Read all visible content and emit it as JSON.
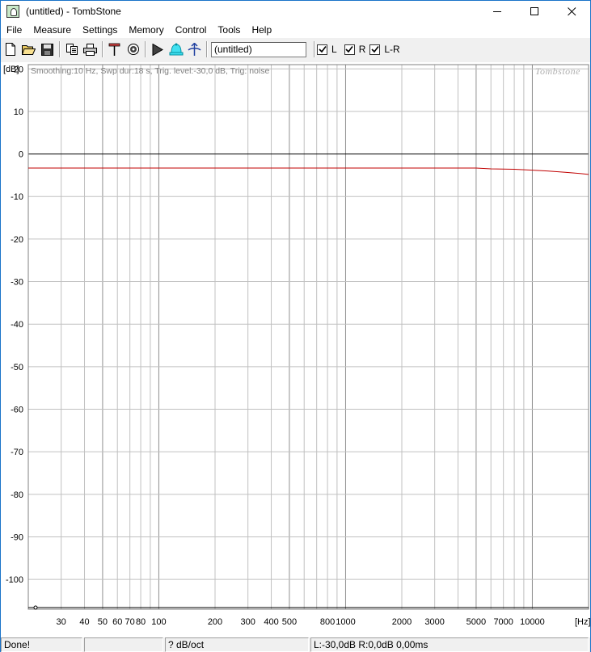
{
  "window": {
    "title": "(untitled) - TombStone"
  },
  "menu": [
    "File",
    "Measure",
    "Settings",
    "Memory",
    "Control",
    "Tools",
    "Help"
  ],
  "toolbar": {
    "name_value": "(untitled)",
    "checkboxes": [
      {
        "label": "L",
        "checked": true
      },
      {
        "label": "R",
        "checked": true
      },
      {
        "label": "L-R",
        "checked": true
      }
    ]
  },
  "graph": {
    "info_text": "Smoothing:10 Hz, Swp dur:18 s, Trig. level:-30,0 dB, Trig: noise",
    "watermark": "Tombstone",
    "y_unit": "[dB]",
    "x_unit": "[Hz]",
    "trace_color": "#c00000"
  },
  "chart_data": {
    "type": "line",
    "xscale": "log",
    "xlim": [
      20,
      20000
    ],
    "ylim": [
      -107,
      21
    ],
    "yticks": [
      20,
      10,
      0,
      -10,
      -20,
      -30,
      -40,
      -50,
      -60,
      -70,
      -80,
      -90,
      -100
    ],
    "xtick_labels": [
      {
        "v": 30,
        "t": "30"
      },
      {
        "v": 40,
        "t": "40"
      },
      {
        "v": 50,
        "t": "50"
      },
      {
        "v": 60,
        "t": "60"
      },
      {
        "v": 70,
        "t": "70"
      },
      {
        "v": 80,
        "t": "80"
      },
      {
        "v": 100,
        "t": "100"
      },
      {
        "v": 200,
        "t": "200"
      },
      {
        "v": 300,
        "t": "300"
      },
      {
        "v": 400,
        "t": "400"
      },
      {
        "v": 500,
        "t": "500"
      },
      {
        "v": 800,
        "t": "800"
      },
      {
        "v": 1000,
        "t": "1000"
      },
      {
        "v": 2000,
        "t": "2000"
      },
      {
        "v": 3000,
        "t": "3000"
      },
      {
        "v": 5000,
        "t": "5000"
      },
      {
        "v": 7000,
        "t": "7000"
      },
      {
        "v": 10000,
        "t": "10000"
      }
    ],
    "series": [
      {
        "x": [
          20,
          100,
          1000,
          5000,
          6000,
          8000,
          10000,
          12000,
          15000,
          18000,
          20000
        ],
        "y": [
          -3.3,
          -3.3,
          -3.3,
          -3.3,
          -3.5,
          -3.6,
          -3.8,
          -4.0,
          -4.3,
          -4.6,
          -4.8
        ]
      }
    ]
  },
  "status": {
    "message": "Done!",
    "slope": "? dB/oct",
    "levels": "L:-30,0dB R:0,0dB 0,00ms"
  }
}
